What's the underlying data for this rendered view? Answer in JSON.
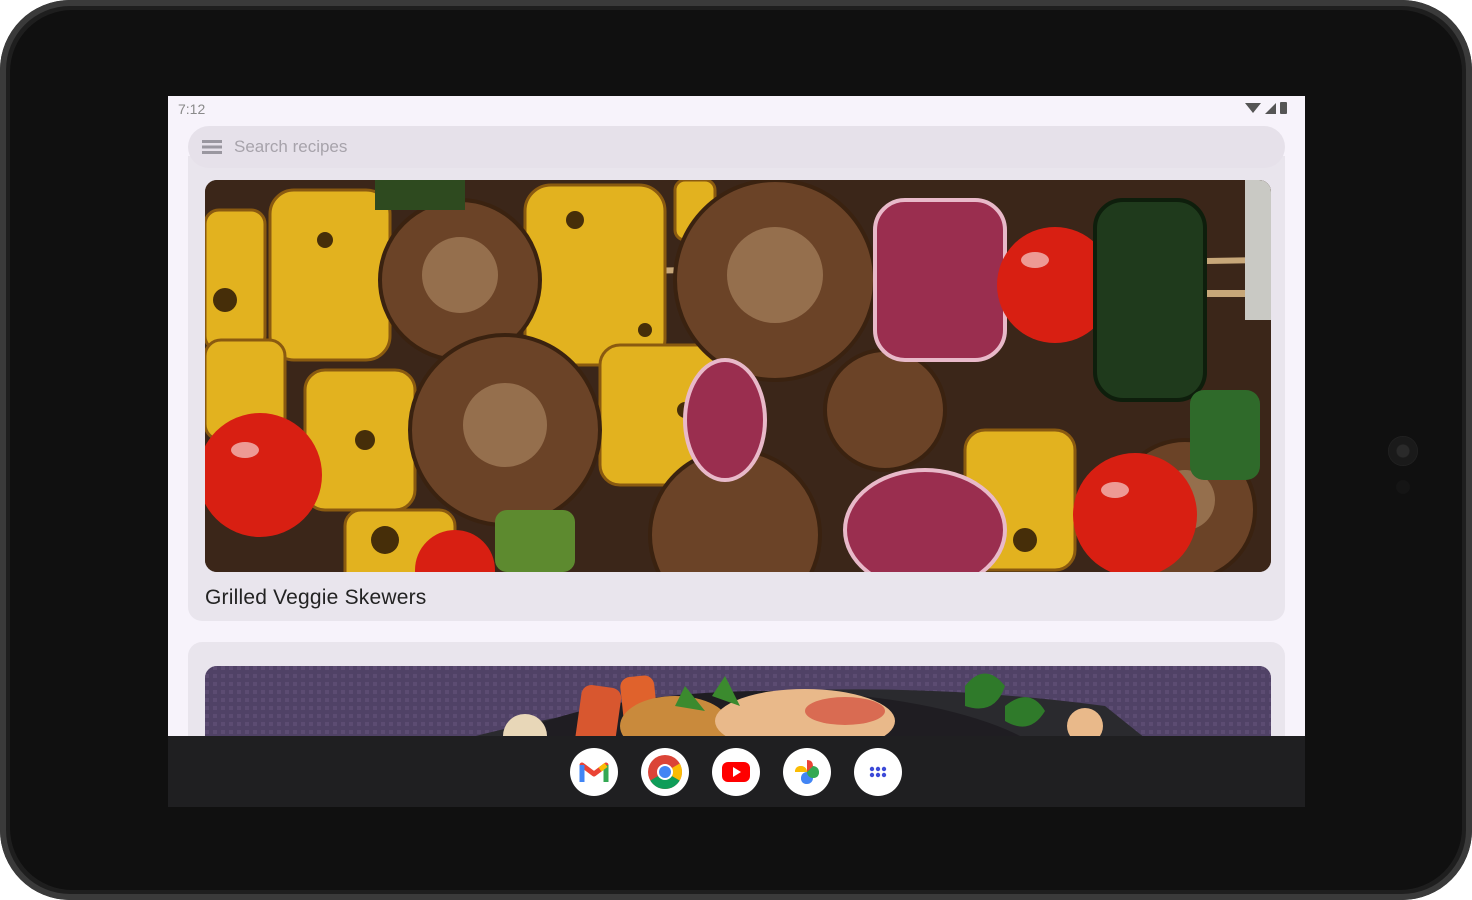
{
  "status_bar": {
    "time": "7:12"
  },
  "search": {
    "placeholder": "Search recipes",
    "value": ""
  },
  "recipes": [
    {
      "title": "Grilled Veggie Skewers"
    },
    {
      "title": ""
    }
  ],
  "dock": {
    "apps": [
      {
        "name": "gmail-icon"
      },
      {
        "name": "chrome-icon"
      },
      {
        "name": "youtube-icon"
      },
      {
        "name": "photos-icon"
      },
      {
        "name": "app-drawer-icon"
      }
    ]
  },
  "colors": {
    "screen_bg": "#f7f3fb",
    "card_bg": "#e9e5ed",
    "search_bg": "#e6e1ea",
    "nav_bg": "#1f1f21"
  }
}
